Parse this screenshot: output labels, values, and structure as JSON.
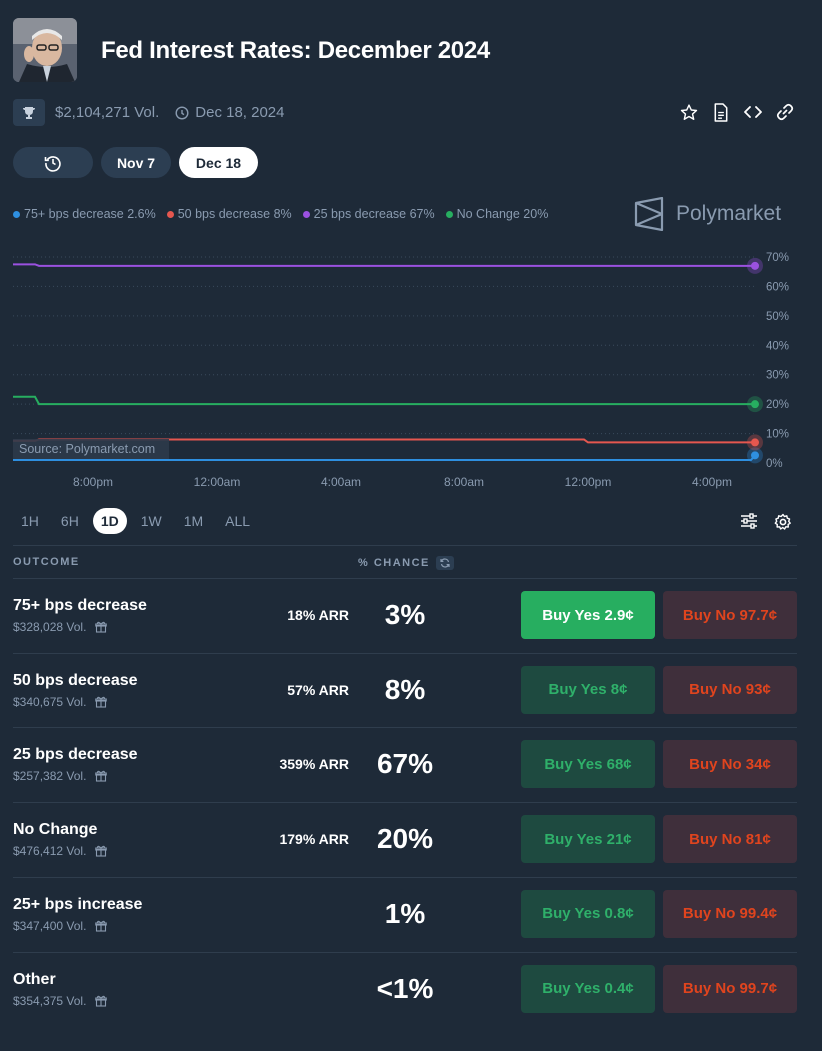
{
  "header": {
    "title": "Fed Interest Rates: December 2024",
    "volume": "$2,104,271 Vol.",
    "end_date": "Dec 18, 2024"
  },
  "date_tabs": {
    "next": "Nov 7",
    "current": "Dec 18"
  },
  "legend": [
    {
      "label": "75+ bps decrease 2.6%",
      "color": "#2e8fe0"
    },
    {
      "label": "50 bps decrease 8%",
      "color": "#e5574f"
    },
    {
      "label": "25 bps decrease 67%",
      "color": "#9b51e0"
    },
    {
      "label": "No Change 20%",
      "color": "#27ae60"
    }
  ],
  "brand": "Polymarket",
  "watermark": "Source: Polymarket.com",
  "chart_data": {
    "type": "line",
    "x": [
      "7:00pm",
      "8:00pm",
      "12:00am",
      "4:00am",
      "8:00am",
      "12:00pm",
      "4:00pm",
      "4:30pm"
    ],
    "x_ticks": [
      "8:00pm",
      "12:00am",
      "4:00am",
      "8:00am",
      "12:00pm",
      "4:00pm"
    ],
    "y_ticks": [
      "0%",
      "10%",
      "20%",
      "30%",
      "40%",
      "50%",
      "60%",
      "70%"
    ],
    "ylim": [
      0,
      70
    ],
    "series": [
      {
        "name": "75+ bps decrease",
        "color": "#2e8fe0",
        "values": [
          1,
          1,
          1,
          1,
          1,
          1,
          1,
          2.6
        ]
      },
      {
        "name": "50 bps decrease",
        "color": "#e5574f",
        "values": [
          7.5,
          8,
          8,
          8,
          8,
          7,
          7,
          7
        ]
      },
      {
        "name": "25 bps decrease",
        "color": "#9b51e0",
        "values": [
          67.5,
          67,
          67,
          67,
          67,
          67,
          67,
          67
        ]
      },
      {
        "name": "No Change",
        "color": "#27ae60",
        "values": [
          22.5,
          20,
          20,
          20,
          20,
          20,
          20,
          20
        ]
      }
    ]
  },
  "ranges": [
    "1H",
    "6H",
    "1D",
    "1W",
    "1M",
    "ALL"
  ],
  "active_range": "1D",
  "table": {
    "header_outcome": "OUTCOME",
    "header_chance": "% CHANCE",
    "rows": [
      {
        "name": "75+ bps decrease",
        "vol": "$328,028 Vol.",
        "arr": "18% ARR",
        "pct": "3%",
        "yes": "Buy Yes 2.9¢",
        "no": "Buy No 97.7¢"
      },
      {
        "name": "50 bps decrease",
        "vol": "$340,675 Vol.",
        "arr": "57% ARR",
        "pct": "8%",
        "yes": "Buy Yes 8¢",
        "no": "Buy No 93¢"
      },
      {
        "name": "25 bps decrease",
        "vol": "$257,382 Vol.",
        "arr": "359% ARR",
        "pct": "67%",
        "yes": "Buy Yes 68¢",
        "no": "Buy No 34¢"
      },
      {
        "name": "No Change",
        "vol": "$476,412 Vol.",
        "arr": "179% ARR",
        "pct": "20%",
        "yes": "Buy Yes 21¢",
        "no": "Buy No 81¢"
      },
      {
        "name": "25+ bps increase",
        "vol": "$347,400 Vol.",
        "arr": "",
        "pct": "1%",
        "yes": "Buy Yes 0.8¢",
        "no": "Buy No 99.4¢"
      },
      {
        "name": "Other",
        "vol": "$354,375 Vol.",
        "arr": "",
        "pct": "<1%",
        "yes": "Buy Yes 0.4¢",
        "no": "Buy No 99.7¢"
      }
    ]
  }
}
